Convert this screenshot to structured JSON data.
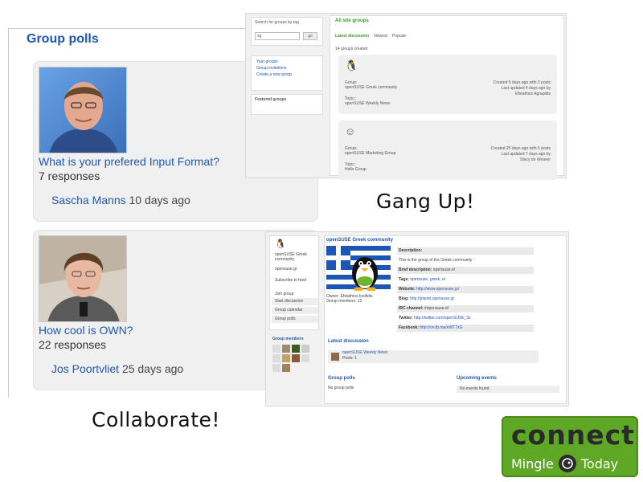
{
  "polls_panel": {
    "title": "Group polls",
    "polls": [
      {
        "question": "What is your prefered Input Format?",
        "responses": "7 responses",
        "author": "Sascha Manns",
        "ago": "10 days ago"
      },
      {
        "question": "How cool is OWN?",
        "responses": "22 responses",
        "author": "Jos Poortvliet",
        "ago": "25 days ago"
      }
    ]
  },
  "groups_screenshot": {
    "search_label": "Search for groups by tag",
    "search_value": "sg",
    "search_button": "go",
    "links": [
      "Your groups",
      "Group invitations",
      "Create a new group"
    ],
    "featured_label": "Featured groups",
    "title": "All site groups",
    "tabs": [
      "Latest discussion",
      "Newest",
      "Popular"
    ],
    "count": "14 groups created",
    "groups": [
      {
        "group_label": "Group:",
        "group": "openSUSE Greek community",
        "topic_label": "Topic:",
        "topic": "openSUSE Weekly News",
        "meta1": "Created 5 days ago with 3 posts",
        "meta2": "Last updated 4 days ago by",
        "meta3": "Efstathios Agrapidis"
      },
      {
        "group_label": "Group:",
        "group": "openSUSE Marketing Group",
        "topic_label": "Topic:",
        "topic": "Hello Group",
        "meta1": "Created 25 days ago with 5 posts",
        "meta2": "Last updated 7 days ago by",
        "meta3": "Stacy de Weaver"
      }
    ]
  },
  "group_page_screenshot": {
    "side_name": "openSUSE Greek community",
    "side_url": "opensuse.gr",
    "side_feed": "Subscribe to feed",
    "side_actions": [
      "Join group",
      "Start discussion",
      "Group calendar",
      "Group polls"
    ],
    "members_title": "Group members",
    "title": "openSUSE Greek community",
    "owner": "Owner: Efstathios Iosifidis",
    "members": "Group members: 12",
    "rows": [
      {
        "k": "Description:",
        "v": ""
      },
      {
        "k": "",
        "v": "This is the group of the Greek community"
      },
      {
        "k": "Brief description:",
        "v": "opensuse.el"
      },
      {
        "k": "Tags:",
        "v": "opensuse, greek, el"
      },
      {
        "k": "Website:",
        "v": "http://www.opensuse.gr/"
      },
      {
        "k": "Blog:",
        "v": "http://planet.opensuse.gr"
      },
      {
        "k": "IRC channel:",
        "v": "#opensuse-el"
      },
      {
        "k": "Twitter:",
        "v": "http://twitter.com/openSUSE_Gr"
      },
      {
        "k": "Facebook:",
        "v": "http://on.fb.me/eWT7xG"
      }
    ],
    "latest_title": "Latest discussion",
    "latest_item": "openSUSE Weekly News",
    "latest_posts": "Posts: 1",
    "polls_title": "Group polls",
    "polls_empty": "No group polls",
    "events_title": "Upcoming events",
    "events_empty": "No events found."
  },
  "captions": {
    "gang_up": "Gang Up!",
    "collaborate": "Collaborate!"
  },
  "logo": {
    "word": "connect",
    "left": "Mingle",
    "right": "Today"
  }
}
